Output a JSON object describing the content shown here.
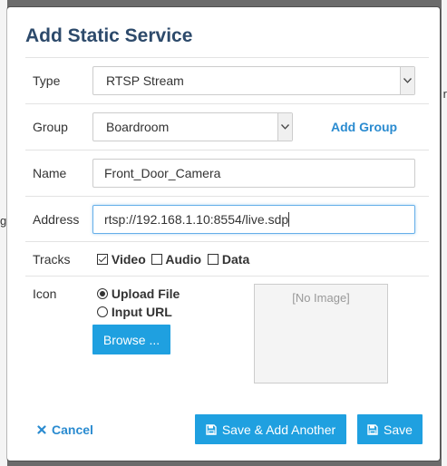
{
  "background": {
    "text_right": "r",
    "text_left": "g"
  },
  "dialog": {
    "title": "Add Static Service"
  },
  "form": {
    "type": {
      "label": "Type",
      "value": "RTSP Stream"
    },
    "group": {
      "label": "Group",
      "value": "Boardroom",
      "add_link": "Add Group"
    },
    "name": {
      "label": "Name",
      "value": "Front_Door_Camera"
    },
    "address": {
      "label": "Address",
      "value": "rtsp://192.168.1.10:8554/live.sdp"
    },
    "tracks": {
      "label": "Tracks",
      "items": [
        {
          "label": "Video",
          "checked": true
        },
        {
          "label": "Audio",
          "checked": false
        },
        {
          "label": "Data",
          "checked": false
        }
      ]
    },
    "icon": {
      "label": "Icon",
      "options": [
        {
          "label": "Upload File",
          "selected": true
        },
        {
          "label": "Input URL",
          "selected": false
        }
      ],
      "browse_label": "Browse ...",
      "preview_text": "[No Image]"
    }
  },
  "footer": {
    "cancel_label": "Cancel",
    "save_add_label": "Save & Add Another",
    "save_label": "Save"
  },
  "colors": {
    "accent": "#1fa0e0",
    "link": "#2a8bd0",
    "title": "#2d4a6b"
  }
}
